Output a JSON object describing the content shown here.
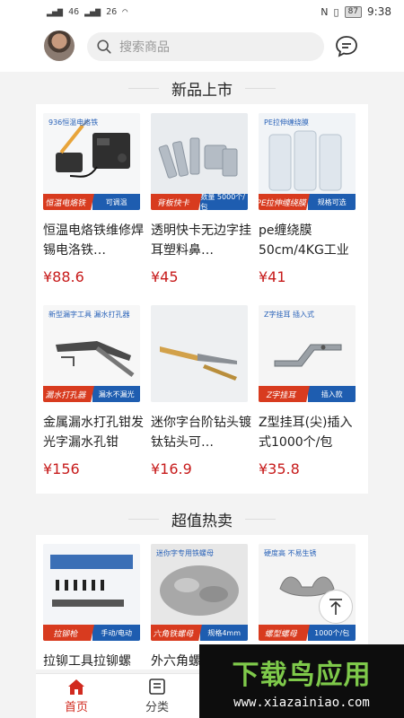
{
  "status": {
    "signal1": "46",
    "signal2": "26",
    "battery": "87",
    "time": "9:38"
  },
  "header": {
    "search_placeholder": "搜索商品"
  },
  "sections": [
    {
      "title": "新品上市",
      "products": [
        {
          "title": "恒温电烙铁维修焊锡电洛铁…",
          "price": "¥88.6",
          "band_left": "恒温电烙铁",
          "band_right": "可调温",
          "top_label": "936恒温电烙铁",
          "image_colors": [
            "#2f2f2f",
            "#e8a43a"
          ]
        },
        {
          "title": "透明快卡无边字挂耳塑料鼻…",
          "price": "¥45",
          "band_left": "背板快卡",
          "band_right": "数量 5000个/包",
          "top_label": "",
          "image_colors": [
            "#cfd5db",
            "#9aa6b2"
          ]
        },
        {
          "title": "pe缠绕膜50cm/4KG工业用…",
          "price": "¥41",
          "band_left": "PE拉伸缠绕膜",
          "band_right": "规格可选",
          "top_label": "PE拉伸缠绕膜",
          "image_colors": [
            "#e9edf2",
            "#c9d4de"
          ]
        },
        {
          "title": "金属漏水打孔钳发光字漏水孔钳",
          "price": "¥156",
          "band_left": "漏水打孔器",
          "band_right": "漏水不漏光",
          "top_label": "新型漏字工具 漏水打孔器",
          "image_colors": [
            "#4a4a4a",
            "#9b9b9b"
          ]
        },
        {
          "title": "迷你字台阶钻头镀钛钻头可…",
          "price": "¥16.9",
          "band_left": "",
          "band_right": "",
          "top_label": "",
          "image_colors": [
            "#d2a14a",
            "#6f7378"
          ]
        },
        {
          "title": "Z型挂耳(尖)插入式1000个/包",
          "price": "¥35.8",
          "band_left": "Z字挂耳",
          "band_right": "插入款",
          "top_label": "Z字挂耳 插入式",
          "image_colors": [
            "#8a8f94",
            "#b9bec3"
          ]
        }
      ]
    },
    {
      "title": "超值热卖",
      "products": [
        {
          "title": "拉铆工具拉铆螺",
          "price": "",
          "band_left": "拉铆枪",
          "band_right": "手动/电动",
          "top_label": "",
          "image_colors": [
            "#3b6fb6",
            "#222222"
          ]
        },
        {
          "title": "外六角螺",
          "price": "",
          "band_left": "六角铁螺母",
          "band_right": "规格4mm",
          "top_label": "迷你字专用铁螺母",
          "image_colors": [
            "#9a9a9a",
            "#c4c4c4"
          ]
        },
        {
          "title": "",
          "price": "",
          "band_left": "螺型螺母",
          "band_right": "1000个/包",
          "top_label": "硬度高 不易生锈",
          "image_colors": [
            "#8c8c8c",
            "#b8b8b8"
          ]
        }
      ]
    }
  ],
  "nav": {
    "home": "首页",
    "category": "分类"
  },
  "watermark": {
    "title": "下载鸟应用",
    "url": "www.xiazainiao.com"
  },
  "colors": {
    "accent": "#d12a1f",
    "price": "#c71b1b"
  }
}
